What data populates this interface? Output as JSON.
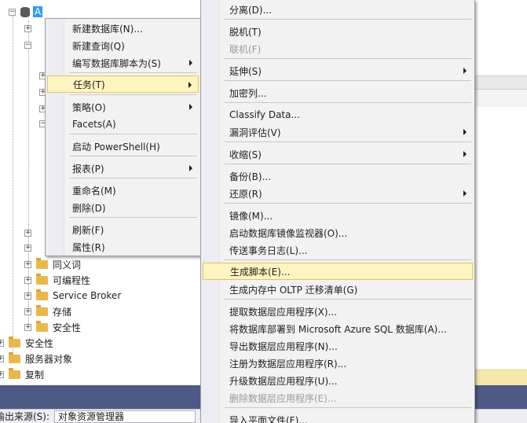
{
  "tree": {
    "selected_label": "A",
    "items": [
      {
        "label": "同义词"
      },
      {
        "label": "可编程性"
      },
      {
        "label": "Service Broker"
      },
      {
        "label": "存储"
      },
      {
        "label": "安全性"
      },
      {
        "label": "安全性"
      },
      {
        "label": "服务器对象"
      },
      {
        "label": "复制"
      }
    ]
  },
  "context_menu": {
    "items": [
      {
        "label": "新建数据库(N)..."
      },
      {
        "label": "新建查询(Q)"
      },
      {
        "label": "编写数据库脚本为(S)",
        "submenu": true
      },
      {
        "label": "任务(T)",
        "submenu": true,
        "highlighted": true
      },
      {
        "label": "策略(O)",
        "submenu": true
      },
      {
        "label": "Facets(A)"
      },
      {
        "label": "启动 PowerShell(H)"
      },
      {
        "label": "报表(P)",
        "submenu": true
      },
      {
        "label": "重命名(M)"
      },
      {
        "label": "删除(D)"
      },
      {
        "label": "刷新(F)"
      },
      {
        "label": "属性(R)"
      }
    ]
  },
  "tasks_submenu": {
    "items": [
      {
        "label": "分离(D)..."
      },
      {
        "label": "脱机(T)"
      },
      {
        "label": "联机(F)",
        "disabled": true
      },
      {
        "label": "延伸(S)",
        "submenu": true
      },
      {
        "label": "加密列..."
      },
      {
        "label": "Classify Data..."
      },
      {
        "label": "漏洞评估(V)",
        "submenu": true
      },
      {
        "label": "收缩(S)",
        "submenu": true
      },
      {
        "label": "备份(B)..."
      },
      {
        "label": "还原(R)",
        "submenu": true
      },
      {
        "label": "镜像(M)..."
      },
      {
        "label": "启动数据库镜像监视器(O)..."
      },
      {
        "label": "传送事务日志(L)..."
      },
      {
        "label": "生成脚本(E)...",
        "highlighted": true
      },
      {
        "label": "生成内存中 OLTP 迁移清单(G)"
      },
      {
        "label": "提取数据层应用程序(X)..."
      },
      {
        "label": "将数据库部署到 Microsoft Azure SQL 数据库(A)..."
      },
      {
        "label": "导出数据层应用程序(N)..."
      },
      {
        "label": "注册为数据层应用程序(R)..."
      },
      {
        "label": "升级数据层应用程序(U)..."
      },
      {
        "label": "删除数据层应用程序(E)...",
        "disabled": true
      },
      {
        "label": "导入平面文件(F)..."
      }
    ]
  },
  "status_bar": {
    "source_label": "输出来源(S):",
    "source_value": "对象资源管理器"
  },
  "colors": {
    "selection": "#3399ff",
    "menu_highlight": "#fdf4bf",
    "menu_highlight_border": "#e5c365",
    "status_band": "#4d5a86"
  }
}
